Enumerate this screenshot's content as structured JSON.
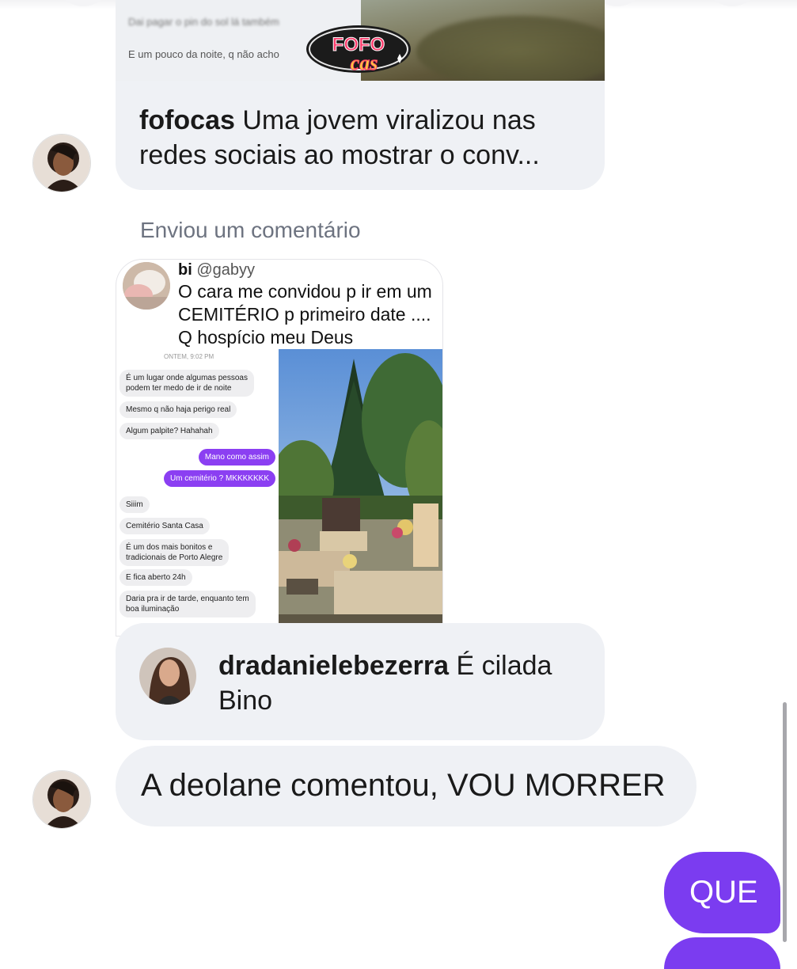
{
  "shared_post": {
    "preview_lines": [
      "Dai pagar o pin do sol lá também",
      "E um pouco da noite, q não acho"
    ],
    "logo_text": "FOFO CAS",
    "account": "fofocas",
    "caption": "Uma jovem viralizou nas redes sociais ao mostrar o conv..."
  },
  "sent_label": "Enviou um comentário",
  "tweet": {
    "name": "bi",
    "handle": "@gabyy",
    "text": "O cara me convidou p ir em um CEMITÉRIO p primeiro date .... Q hospício meu Deus",
    "chat_time": "ONTEM, 9:02 PM",
    "chat": [
      {
        "dir": "in",
        "text": "É um lugar onde algumas pessoas\npodem ter medo de ir de noite"
      },
      {
        "dir": "in",
        "text": "Mesmo q não haja perigo real"
      },
      {
        "dir": "in",
        "text": "Algum palpite? Hahahah"
      },
      {
        "dir": "out",
        "text": "Mano como assim"
      },
      {
        "dir": "out",
        "text": "Um cemitério ? MKKKKKKK"
      },
      {
        "dir": "in",
        "text": "Siiim"
      },
      {
        "dir": "in",
        "text": "Cemitério Santa Casa"
      },
      {
        "dir": "in",
        "text": "É um dos mais bonitos e\ntradicionais de Porto Alegre"
      },
      {
        "dir": "in",
        "text": "E fica aberto 24h"
      },
      {
        "dir": "in",
        "text": "Daria pra ir de tarde, enquanto tem\nboa iluminação"
      }
    ]
  },
  "reply": {
    "account": "dradanielebezerra",
    "text": "É cilada Bino"
  },
  "messages": {
    "received": "A deolane comentou, VOU MORRER",
    "sent": "QUE"
  },
  "colors": {
    "bubble_received": "#eff1f5",
    "bubble_sent": "#7b3cf0",
    "chat_sent": "#8b3ff2"
  }
}
